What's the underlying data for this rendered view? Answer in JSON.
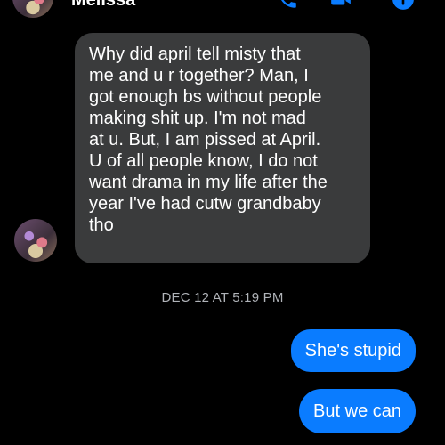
{
  "header": {
    "contact_name": "Melissa",
    "icons": [
      "phone-icon",
      "video-camera-icon",
      "info-icon"
    ],
    "accent_color": "#0a7cff"
  },
  "messages": {
    "incoming": {
      "text": "Why did april tell  misty that\nme and u r together?  Man, I\ngot enough bs without people\nmaking shit up.  I'm not mad\nat u.  But, I am pissed at April.\nU of all people know, I do not\nwant drama in my life after the\nyear I've had cutw grandbaby\ntho"
    },
    "timestamp": "DEC 12 AT 5:19 PM",
    "outgoing": [
      {
        "text": "She's stupid"
      },
      {
        "text": "But we can"
      }
    ]
  }
}
